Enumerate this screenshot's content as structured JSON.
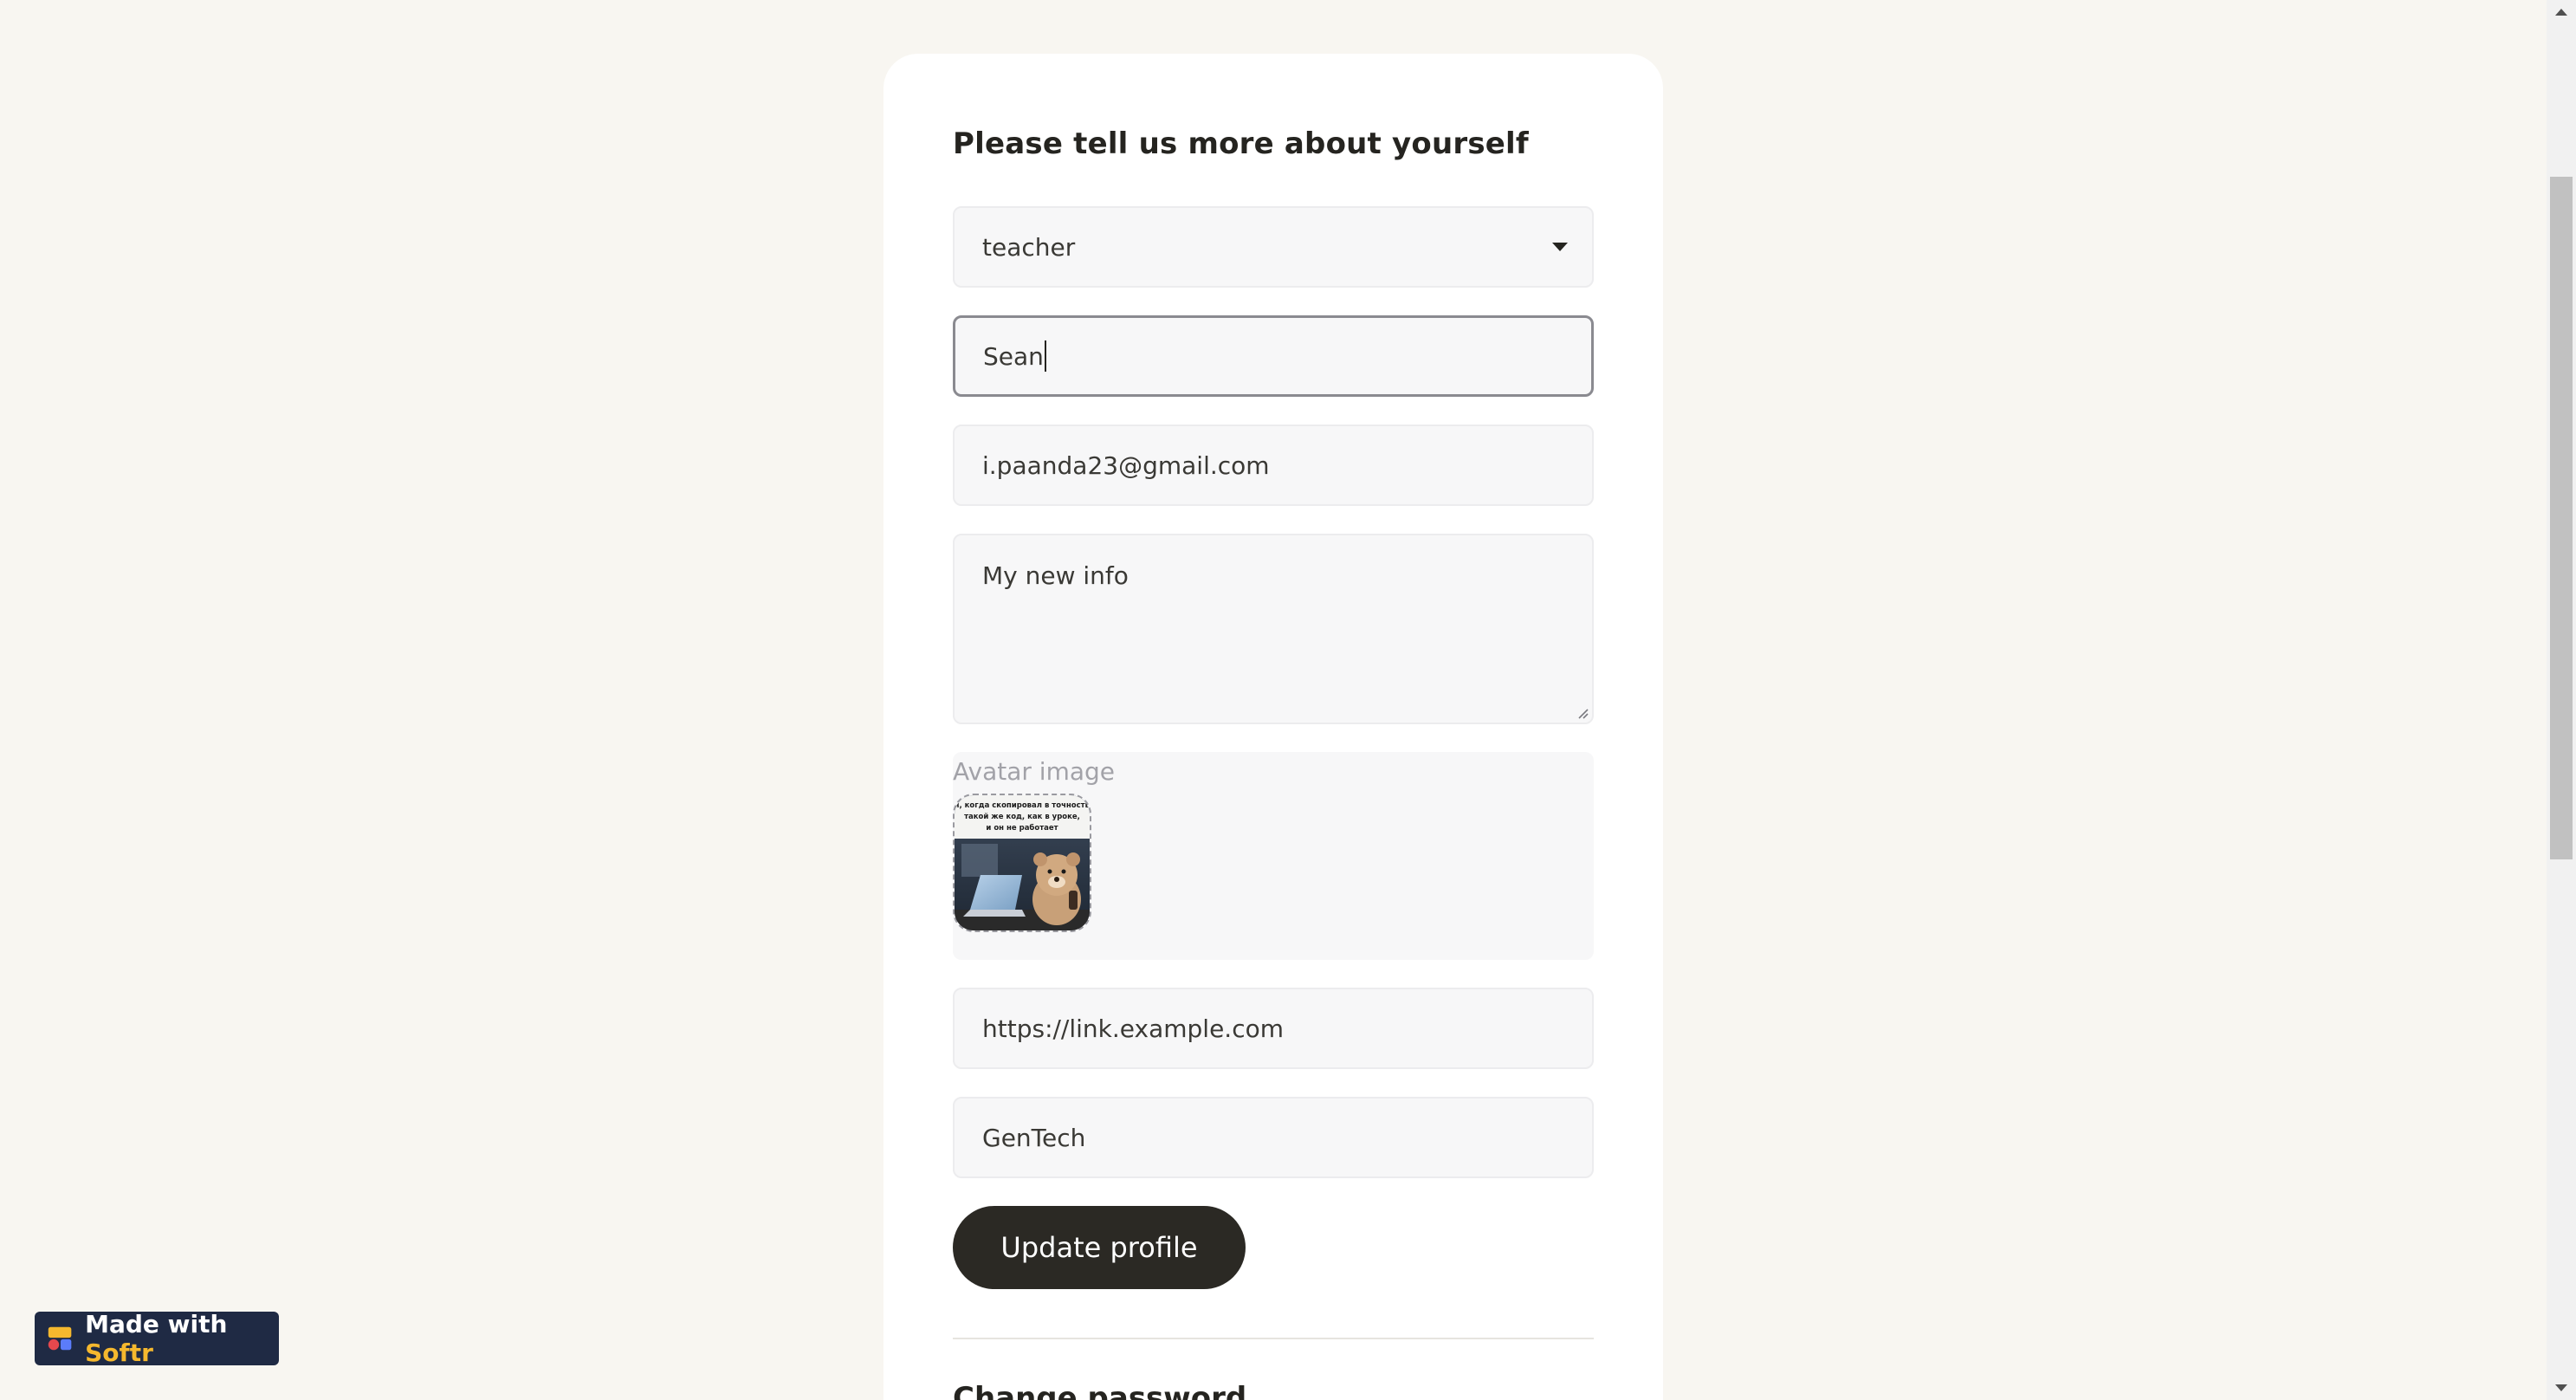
{
  "form": {
    "title": "Please tell us more about yourself",
    "role_value": "teacher",
    "name_value": "Sean",
    "email_value": "i.paanda23@gmail.com",
    "bio_value": "My new info",
    "avatar_label": "Avatar image",
    "avatar_caption": "я, когда скопировал в точность такой же код, как в уроке, и он не работает",
    "link_value": "https://link.example.com",
    "company_value": "GenTech",
    "update_button_label": "Update profile",
    "next_section_title": "Change password"
  },
  "badge": {
    "prefix": "Made with ",
    "brand": "Softr"
  },
  "icons": {
    "dropdown": "caret-down-icon",
    "resize": "resize-handle-icon",
    "badge_logo": "softr-logo-icon"
  },
  "colors": {
    "page_background": "#f8f6f1",
    "card_background": "#ffffff",
    "button_background": "#2b2924",
    "badge_background": "#1f2a44",
    "badge_brand": "#f5b82e"
  }
}
